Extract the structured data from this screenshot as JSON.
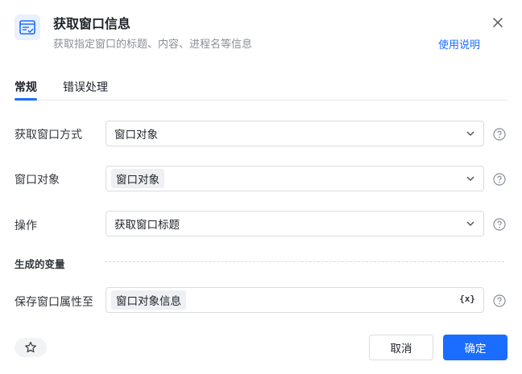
{
  "header": {
    "title": "获取窗口信息",
    "subtitle": "获取指定窗口的标题、内容、进程名等信息",
    "help_link": "使用说明"
  },
  "tabs": [
    {
      "label": "常规",
      "active": true
    },
    {
      "label": "错误处理",
      "active": false
    }
  ],
  "fields": {
    "method": {
      "label": "获取窗口方式",
      "value": "窗口对象"
    },
    "window_object": {
      "label": "窗口对象",
      "value": "窗口对象"
    },
    "operation": {
      "label": "操作",
      "value": "获取窗口标题"
    }
  },
  "output_section": {
    "title": "生成的变量",
    "save_to": {
      "label": "保存窗口属性至",
      "value": "窗口对象信息",
      "var_button": "{x}"
    }
  },
  "footer": {
    "cancel_label": "取消",
    "ok_label": "确定"
  },
  "colors": {
    "accent": "#1a6dff",
    "chip_bg": "#eef0f3",
    "border": "#d9dce1"
  },
  "icons": {
    "header": "window-info-icon",
    "close": "close-icon",
    "dropdown": "chevron-down-icon",
    "help": "question-circle-icon",
    "favorite": "star-icon"
  }
}
